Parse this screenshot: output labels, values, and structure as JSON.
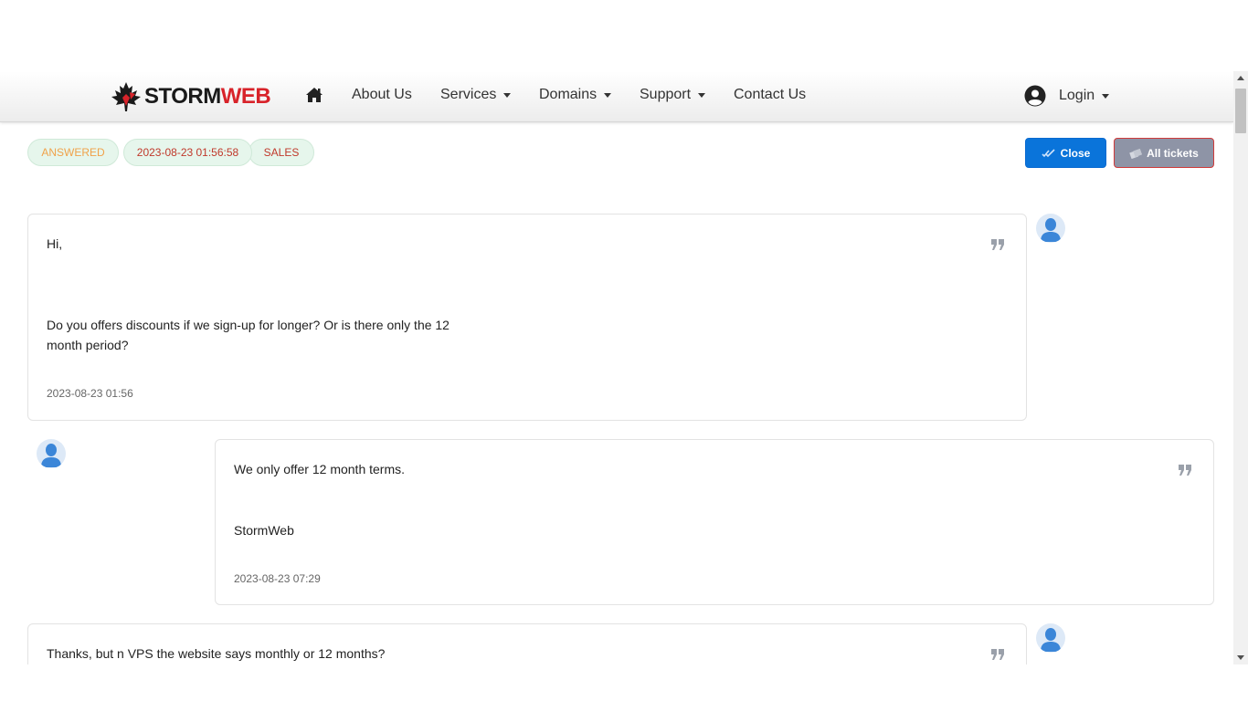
{
  "brand": {
    "name_part1": "STORM",
    "name_part2": "WEB"
  },
  "nav": {
    "about": "About Us",
    "services": "Services",
    "domains": "Domains",
    "support": "Support",
    "contact": "Contact Us",
    "login": "Login"
  },
  "ticket": {
    "status": "ANSWERED",
    "date": "2023-08-23 01:56:58",
    "department": "SALES",
    "close_label": "Close",
    "all_tickets_label": "All tickets"
  },
  "messages": [
    {
      "greeting": "Hi,",
      "line1": "Do you offers discounts if we sign-up for longer? Or is there only the 12",
      "line2": "month period?",
      "timestamp": "2023-08-23 01:56"
    },
    {
      "line1": "We only offer 12 month terms.",
      "signature": "StormWeb",
      "timestamp": "2023-08-23 07:29"
    },
    {
      "line1": "Thanks, but n VPS the website says monthly or 12 months?"
    }
  ],
  "icons": {
    "home": "home-icon",
    "user": "user-circle-icon",
    "quote": "quote-icon",
    "close": "double-check-icon",
    "all_tickets": "tickets-icon",
    "avatar": "person-avatar-icon"
  },
  "colors": {
    "brand_red": "#d8232a",
    "close_button": "#0a74da",
    "all_tickets_button": "#8e94a6",
    "badge_bg": "#e6f6ec",
    "status_orange": "#f0a24a"
  }
}
